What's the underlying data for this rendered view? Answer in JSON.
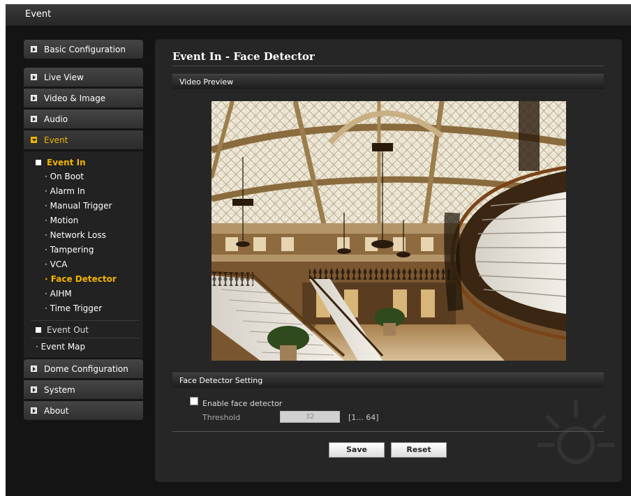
{
  "window": {
    "title": "Event"
  },
  "nav": {
    "basic_configuration": "Basic Configuration",
    "live_view": "Live View",
    "video_image": "Video & Image",
    "audio": "Audio",
    "event": "Event",
    "dome_configuration": "Dome Configuration",
    "system": "System",
    "about": "About"
  },
  "event_menu": {
    "event_in": "Event In",
    "items": [
      "On Boot",
      "Alarm In",
      "Manual Trigger",
      "Motion",
      "Network Loss",
      "Tampering",
      "VCA",
      "Face Detector",
      "AIHM",
      "Time Trigger"
    ],
    "selected": "Face Detector",
    "event_out": "Event Out",
    "event_map": "Event Map"
  },
  "main": {
    "page_title": "Event In - Face Detector",
    "video_preview_label": "Video Preview",
    "setting_label": "Face Detector Setting",
    "enable_label": "Enable face detector",
    "enable_checked": false,
    "threshold_label": "Threshold",
    "threshold_value": "32",
    "threshold_range": "[1... 64]",
    "save_label": "Save",
    "reset_label": "Reset"
  },
  "colors": {
    "accent": "#f2b400",
    "background": "#141414",
    "panel": "#262626"
  },
  "icons": [
    "arrow-bullet-icon",
    "expand-arrow-icon",
    "square-bullet-icon",
    "sun-watermark-icon"
  ]
}
